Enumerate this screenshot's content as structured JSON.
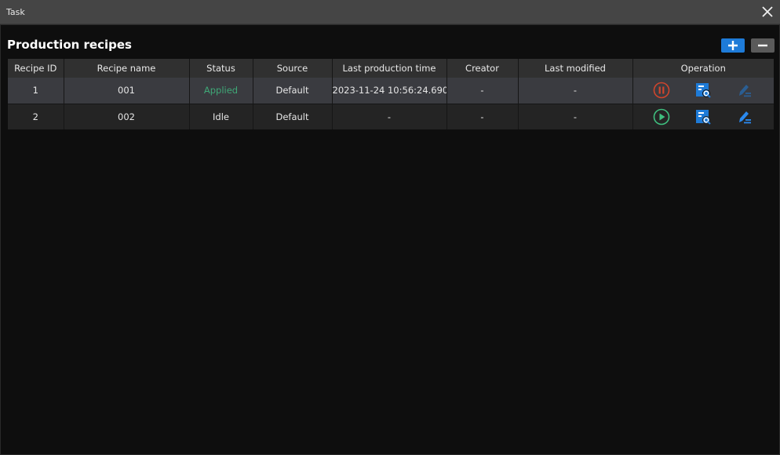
{
  "window": {
    "title": "Task",
    "close_icon": "close-icon"
  },
  "page": {
    "heading": "Production recipes",
    "add_button_icon": "plus-icon",
    "remove_button_icon": "minus-icon",
    "colors": {
      "accent": "#1e7bd8",
      "applied": "#3fa877",
      "stop": "#d0452c",
      "start": "#3fbf7f"
    }
  },
  "table": {
    "columns": [
      "Recipe ID",
      "Recipe name",
      "Status",
      "Source",
      "Last production time",
      "Creator",
      "Last modified",
      "Operation"
    ],
    "rows": [
      {
        "id": "1",
        "name": "001",
        "status": "Applied",
        "source": "Default",
        "last_production_time": "2023-11-24 10:56:24.690",
        "creator": "-",
        "last_modified": "-",
        "operations": [
          "pause-icon",
          "view-details-icon",
          "edit-icon"
        ],
        "edit_enabled": false
      },
      {
        "id": "2",
        "name": "002",
        "status": "Idle",
        "source": "Default",
        "last_production_time": "-",
        "creator": "-",
        "last_modified": "-",
        "operations": [
          "play-icon",
          "view-details-icon",
          "edit-icon"
        ],
        "edit_enabled": true
      }
    ]
  }
}
